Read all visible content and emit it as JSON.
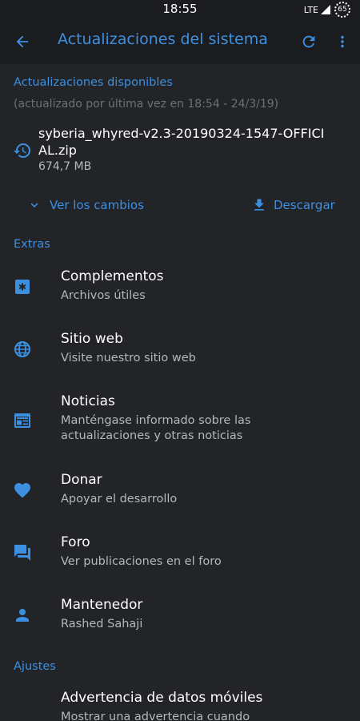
{
  "status_bar": {
    "time": "18:55",
    "network": "LTE",
    "battery": "65"
  },
  "app_bar": {
    "title": "Actualizaciones del sistema"
  },
  "updates": {
    "header": "Actualizaciones disponibles",
    "last_updated": "(actualizado por última vez en 18:54 - 24/3/19)",
    "file_name": "syberia_whyred-v2.3-20190324-1547-OFFICIAL.zip",
    "file_size": "674,7 MB",
    "changes_label": "Ver los cambios",
    "download_label": "Descargar"
  },
  "extras": {
    "header": "Extras",
    "items": [
      {
        "title": "Complementos",
        "summary": "Archivos útiles",
        "icon": "addon-icon"
      },
      {
        "title": "Sitio web",
        "summary": "Visite nuestro sitio web",
        "icon": "globe-icon"
      },
      {
        "title": "Noticias",
        "summary": "Manténgase informado sobre las actualizaciones y otras noticias",
        "icon": "news-icon"
      },
      {
        "title": "Donar",
        "summary": "Apoyar el desarrollo",
        "icon": "heart-icon"
      },
      {
        "title": "Foro",
        "summary": "Ver publicaciones en el foro",
        "icon": "forum-icon"
      },
      {
        "title": "Mantenedor",
        "summary": "Rashed Sahaji",
        "icon": "person-icon"
      }
    ]
  },
  "settings": {
    "header": "Ajustes",
    "items": [
      {
        "title": "Advertencia de datos móviles",
        "summary": "Mostrar una advertencia cuando"
      }
    ]
  },
  "colors": {
    "accent": "#3d8fe0",
    "background": "#222427",
    "toolbar": "#1b1c1f",
    "secondary_text": "#b5b7ba",
    "hint_text": "#6e7074"
  }
}
